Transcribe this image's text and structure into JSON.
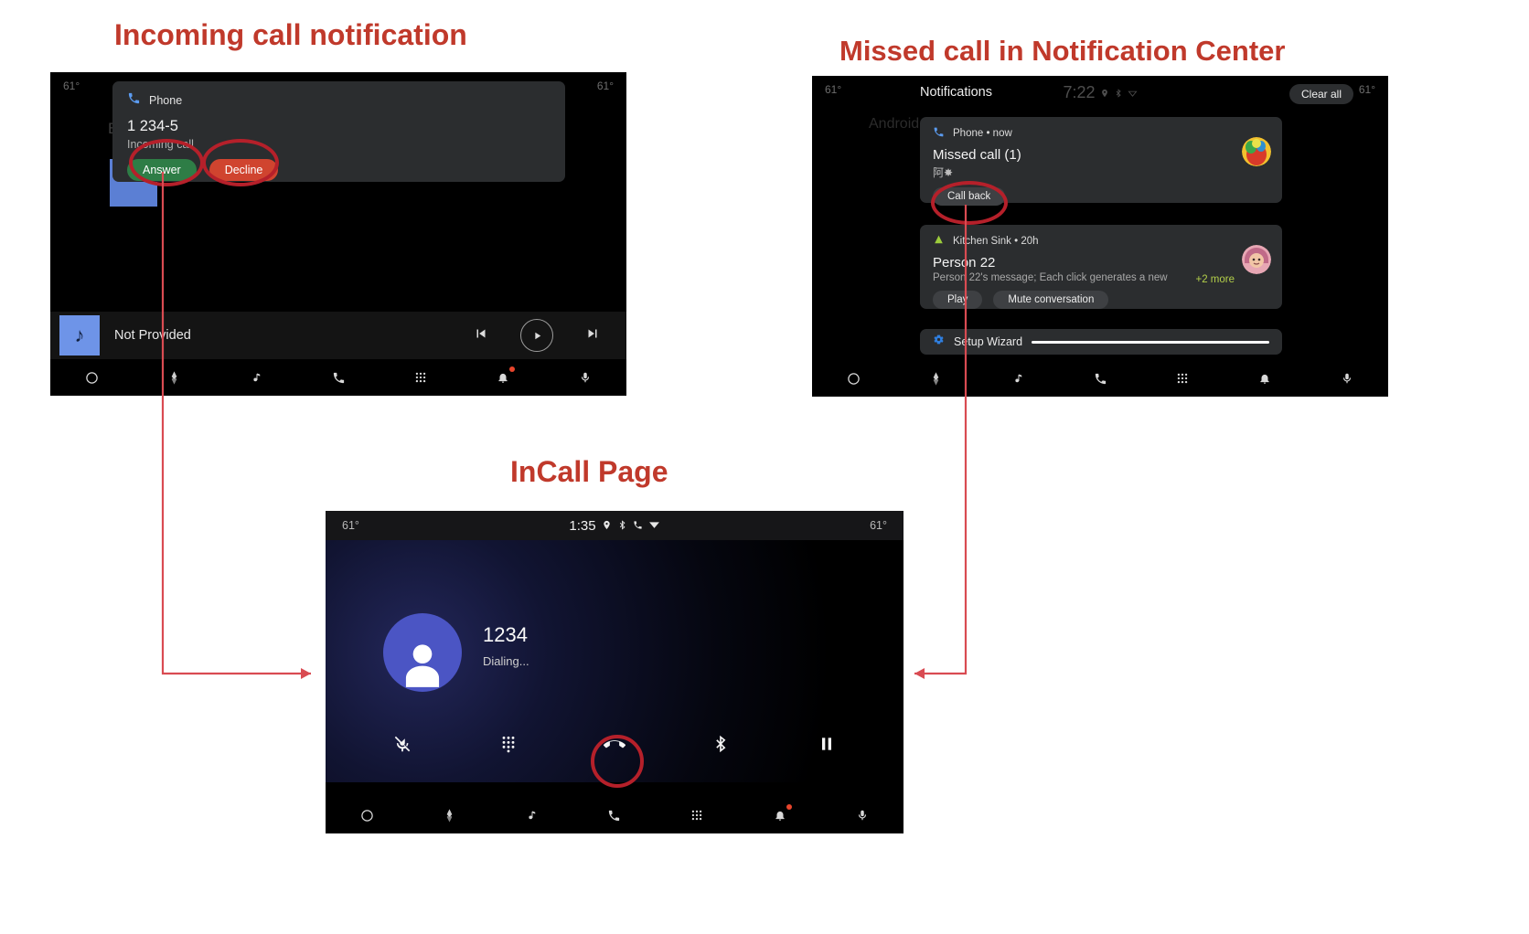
{
  "annotations": {
    "incoming_title": "Incoming call notification",
    "missed_title": "Missed call in Notification Center",
    "incall_title": "InCall Page",
    "accent_color": "#c0392b",
    "marker_color": "#b5202a"
  },
  "screen_incoming": {
    "status_left": "61°",
    "status_right": "61°",
    "background_text": "B",
    "heads_up": {
      "app_name": "Phone",
      "app_icon": "phone-call-icon",
      "title": "1 234-5",
      "subtitle": "Incoming call",
      "answer_label": "Answer",
      "decline_label": "Decline",
      "answer_color": "#2e7d46",
      "decline_color": "#d0442f"
    },
    "media_bar": {
      "art_icon": "music-note-icon",
      "title": "Not Provided",
      "prev_icon": "skip-previous-icon",
      "play_icon": "play-icon",
      "next_icon": "skip-next-icon"
    },
    "navbar": [
      {
        "name": "home-icon"
      },
      {
        "name": "navigation-icon"
      },
      {
        "name": "music-note-icon"
      },
      {
        "name": "phone-icon"
      },
      {
        "name": "apps-grid-icon"
      },
      {
        "name": "bell-icon",
        "badge": true
      },
      {
        "name": "microphone-icon"
      }
    ]
  },
  "screen_notifications": {
    "status_left": "61°",
    "status_right": "61°",
    "title": "Notifications",
    "clock": "7:22",
    "status_icons": [
      "location-icon",
      "bluetooth-icon",
      "wifi-off-icon"
    ],
    "clear_all_label": "Clear all",
    "background_text": "Android",
    "cards": [
      {
        "app_icon": "phone-call-icon",
        "app_line": "Phone • now",
        "title": "Missed call (1)",
        "subtitle": "阿✸",
        "actions": [
          "Call back"
        ],
        "has_avatar": true
      },
      {
        "app_icon": "kitchen-sink-icon",
        "app_line": "Kitchen Sink • 20h",
        "title": "Person 22",
        "subtitle": "Person 22's message; Each click generates a new",
        "more_label": "+2 more",
        "more_color": "#b3cf4a",
        "actions": [
          "Play",
          "Mute conversation"
        ],
        "has_avatar": true
      },
      {
        "app_icon": "gear-icon",
        "app_line": "Setup Wizard",
        "collapsed": true
      }
    ],
    "navbar": [
      {
        "name": "home-icon"
      },
      {
        "name": "navigation-icon"
      },
      {
        "name": "music-note-icon"
      },
      {
        "name": "phone-icon"
      },
      {
        "name": "apps-grid-icon"
      },
      {
        "name": "bell-icon",
        "badge": false
      },
      {
        "name": "microphone-icon"
      }
    ]
  },
  "screen_incall": {
    "status_left": "61°",
    "status_right": "61°",
    "clock": "1:35",
    "status_icons": [
      "location-icon",
      "bluetooth-icon",
      "phone-call-icon",
      "wifi-icon"
    ],
    "caller_number": "1234",
    "caller_status": "Dialing...",
    "avatar_icon": "person-icon",
    "avatar_color": "#4b55c4",
    "controls": [
      {
        "name": "mic-off-icon",
        "label": "Mute"
      },
      {
        "name": "dialpad-icon",
        "label": "Dialpad"
      },
      {
        "name": "end-call-icon",
        "label": "End call",
        "highlighted": true
      },
      {
        "name": "bluetooth-icon",
        "label": "Bluetooth"
      },
      {
        "name": "pause-icon",
        "label": "Hold"
      }
    ],
    "navbar": [
      {
        "name": "home-icon"
      },
      {
        "name": "navigation-icon"
      },
      {
        "name": "music-note-icon"
      },
      {
        "name": "phone-icon"
      },
      {
        "name": "apps-grid-icon"
      },
      {
        "name": "bell-icon",
        "badge": true
      },
      {
        "name": "microphone-icon"
      }
    ]
  }
}
